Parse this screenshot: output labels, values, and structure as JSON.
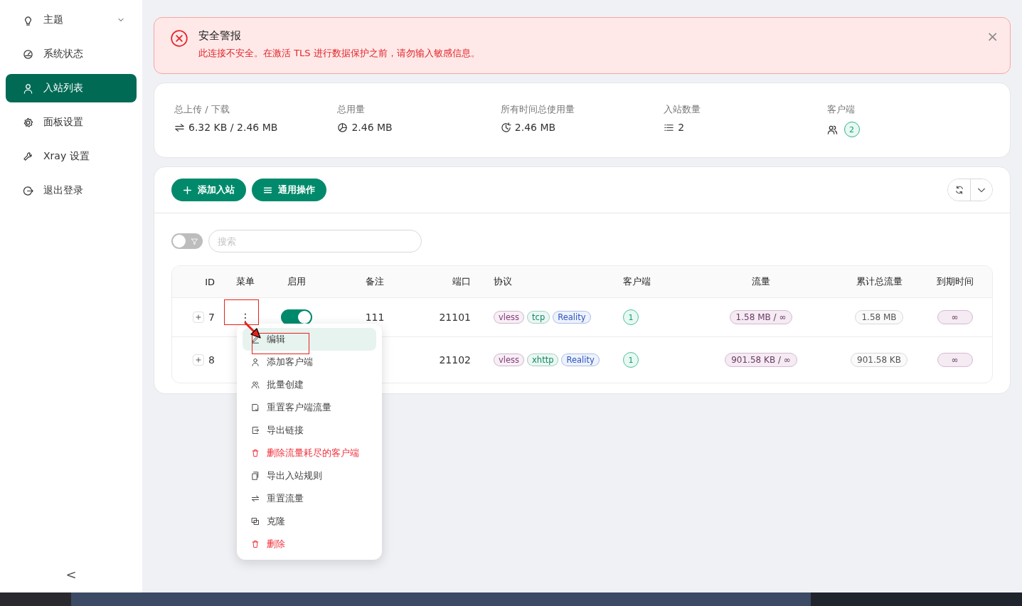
{
  "sidebar": {
    "items": [
      {
        "label": "主题",
        "selected": false,
        "expanded": false
      },
      {
        "label": "系统状态",
        "selected": false
      },
      {
        "label": "入站列表",
        "selected": true
      },
      {
        "label": "面板设置",
        "selected": false
      },
      {
        "label": "Xray 设置",
        "selected": false
      },
      {
        "label": "退出登录",
        "selected": false
      }
    ],
    "collapse": "<"
  },
  "alert": {
    "title": "安全警报",
    "message": "此连接不安全。在激活 TLS 进行数据保护之前，请勿输入敏感信息。",
    "close": "×"
  },
  "stats": [
    {
      "label": "总上传 / 下载",
      "value": "6.32 KB / 2.46 MB"
    },
    {
      "label": "总用量",
      "value": "2.46 MB"
    },
    {
      "label": "所有时间总使用量",
      "value": "2.46 MB"
    },
    {
      "label": "入站数量",
      "value": "2"
    },
    {
      "label": "客户端",
      "value": "2"
    }
  ],
  "toolbar": {
    "buttons": [
      "添加入站",
      "通用操作"
    ]
  },
  "filter": {
    "on": false,
    "search_placeholder": "搜索"
  },
  "table": {
    "columns": [
      "ID",
      "菜单",
      "启用",
      "备注",
      "端口",
      "协议",
      "客户端",
      "流量",
      "累计总流量",
      "到期时间"
    ],
    "rows": [
      {
        "id": "7",
        "expanded": false,
        "menu": "⋮",
        "enabled": true,
        "remark": "111",
        "port": "21101",
        "tags": [
          {
            "label": "vless",
            "color": "#8a3b7c"
          },
          {
            "label": "tcp",
            "color": "#0b8a64"
          },
          {
            "label": "Reality",
            "color": "#2b55c4"
          }
        ],
        "clients": "1",
        "traffic": "1.58 MB / ∞",
        "total": "1.58 MB",
        "expiry": "∞"
      },
      {
        "id": "8",
        "expanded": false,
        "port": "21102",
        "tags": [
          {
            "label": "vless",
            "color": "#8a3b7c"
          },
          {
            "label": "xhttp",
            "color": "#0b8a64"
          },
          {
            "label": "Reality",
            "color": "#2b55c4"
          }
        ],
        "clients": "1",
        "traffic": "901.58 KB / ∞",
        "total": "901.58 KB",
        "expiry": "∞"
      }
    ]
  },
  "menu": {
    "items": [
      {
        "label": "编辑",
        "kind": "normal",
        "selected": true
      },
      {
        "label": "添加客户端",
        "kind": "normal",
        "selected": false
      },
      {
        "label": "批量创建",
        "kind": "normal",
        "selected": false
      },
      {
        "label": "重置客户端流量",
        "kind": "normal",
        "selected": false
      },
      {
        "label": "导出链接",
        "kind": "normal",
        "selected": false
      },
      {
        "label": "删除流量耗尽的客户端",
        "kind": "danger",
        "selected": false
      },
      {
        "label": "导出入站规则",
        "kind": "normal",
        "selected": false
      },
      {
        "label": "重置流量",
        "kind": "normal",
        "selected": false
      },
      {
        "label": "克隆",
        "kind": "normal",
        "selected": false
      },
      {
        "label": "删除",
        "kind": "danger",
        "selected": false
      }
    ]
  }
}
